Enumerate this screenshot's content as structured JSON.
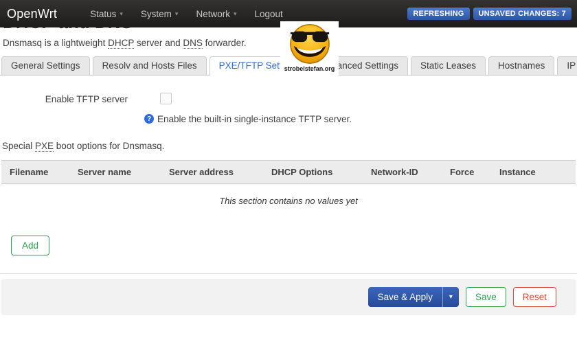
{
  "navbar": {
    "brand": "OpenWrt",
    "menus": [
      {
        "label": "Status",
        "caret": true
      },
      {
        "label": "System",
        "caret": true
      },
      {
        "label": "Network",
        "caret": true
      },
      {
        "label": "Logout",
        "caret": false
      }
    ],
    "badges": [
      {
        "label": "REFRESHING"
      },
      {
        "label": "UNSAVED CHANGES: 7"
      }
    ]
  },
  "logo": {
    "caption": "strobelstefan.org"
  },
  "page": {
    "title": "DHCP and DNS",
    "subtitle": {
      "p0": "Dnsmasq is a lightweight ",
      "abbr1": "DHCP",
      "p1": " server and ",
      "abbr2": "DNS",
      "p2": " forwarder."
    }
  },
  "tabs": [
    {
      "label": "General Settings",
      "active": false
    },
    {
      "label": "Resolv and Hosts Files",
      "active": false
    },
    {
      "label": "PXE/TFTP Settings",
      "active": true
    },
    {
      "label": "Advanced Settings",
      "active": false
    },
    {
      "label": "Static Leases",
      "active": false
    },
    {
      "label": "Hostnames",
      "active": false
    },
    {
      "label": "IP Sets",
      "active": false
    }
  ],
  "form": {
    "tftp_label": "Enable TFTP server",
    "help_icon": "?",
    "tftp_help": "Enable the built-in single-instance TFTP server."
  },
  "section": {
    "intro": {
      "p0": "Special ",
      "abbr": "PXE",
      "p1": " boot options for Dnsmasq."
    },
    "headers": [
      "Filename",
      "Server name",
      "Server address",
      "DHCP Options",
      "Network-ID",
      "Force",
      "Instance"
    ],
    "empty_text": "This section contains no values yet",
    "add_label": "Add"
  },
  "footer": {
    "save_apply": "Save & Apply",
    "caret": "▾",
    "save": "Save",
    "reset": "Reset"
  },
  "icons": {
    "caret_down": "▾"
  },
  "colors": {
    "navbar_bg": "#1d1c1a",
    "badge_blue": "#3c6dc4",
    "active_tab_blue": "#2f6bdb",
    "help_blue": "#2f6bdb",
    "green": "#2ba14d",
    "red": "#df4530",
    "footer_bg": "#f2f2f2"
  }
}
